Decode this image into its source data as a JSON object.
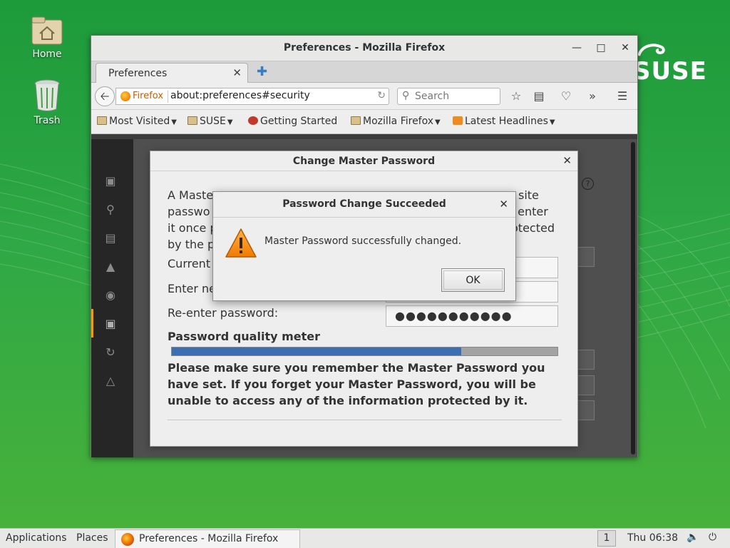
{
  "desktop": {
    "icons": [
      {
        "label": "Home"
      },
      {
        "label": "Trash"
      }
    ],
    "logo_text": "SUSE"
  },
  "firefox": {
    "window_title": "Preferences - Mozilla Firefox",
    "tab_label": "Preferences",
    "identity_label": "Firefox",
    "url": "about:preferences#security",
    "search_placeholder": "Search",
    "bookmarks": [
      {
        "label": "Most Visited",
        "icon": "folder",
        "has_menu": true
      },
      {
        "label": "SUSE",
        "icon": "folder",
        "has_menu": true
      },
      {
        "label": "Getting Started",
        "icon": "chameleon",
        "has_menu": false
      },
      {
        "label": "Mozilla Firefox",
        "icon": "folder",
        "has_menu": true
      },
      {
        "label": "Latest Headlines",
        "icon": "rss",
        "has_menu": true
      }
    ],
    "sidebar_icons": [
      "general-icon",
      "search-icon",
      "content-icon",
      "applications-icon",
      "privacy-icon",
      "security-icon",
      "sync-icon",
      "advanced-icon"
    ],
    "help_glyph": "?"
  },
  "change_master_password": {
    "title": "Change Master Password",
    "intro_lines": [
      "A Master",
      "passwo",
      "it once p",
      "by the p"
    ],
    "intro_right_lines": [
      "site",
      "to enter",
      "otected"
    ],
    "labels": {
      "current": "Current",
      "enter_new": "Enter ne",
      "reenter": "Re-enter password:"
    },
    "reenter_value": "●●●●●●●●●●●",
    "meter_label": "Password quality meter",
    "meter_fraction": 0.75,
    "warning": "Please make sure you remember the Master Password you have set. If you forget your Master Password, you will be unable to access any of the information protected by it."
  },
  "success_dialog": {
    "title": "Password Change Succeeded",
    "message": "Master Password successfully changed.",
    "ok_label": "OK"
  },
  "taskbar": {
    "applications": "Applications",
    "places": "Places",
    "window_label": "Preferences - Mozilla Firefox",
    "workspace": "1",
    "clock": "Thu 06:38"
  }
}
